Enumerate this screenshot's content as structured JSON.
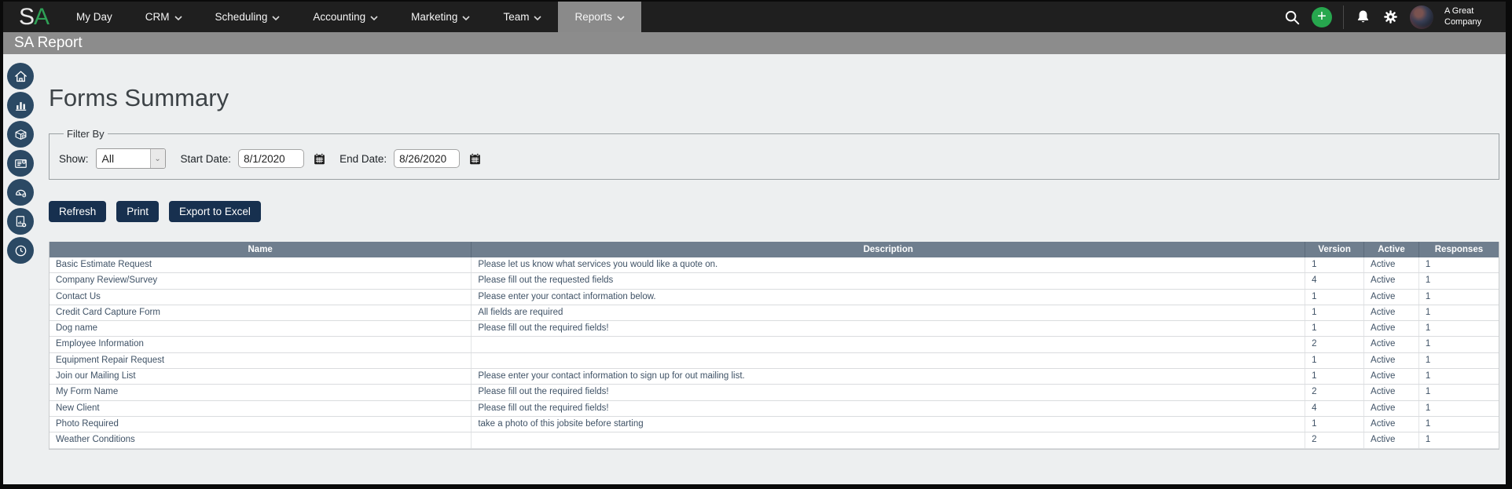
{
  "nav": {
    "logo": {
      "s": "S",
      "a": "A"
    },
    "items": [
      {
        "label": "My Day"
      },
      {
        "label": "CRM"
      },
      {
        "label": "Scheduling"
      },
      {
        "label": "Accounting"
      },
      {
        "label": "Marketing"
      },
      {
        "label": "Team"
      },
      {
        "label": "Reports"
      }
    ],
    "active_item": "Reports",
    "company": "A Great Company",
    "right_icons": [
      "search-icon",
      "add-icon",
      "notifications-icon",
      "settings-icon",
      "avatar"
    ]
  },
  "subheader": {
    "title": "SA Report"
  },
  "sidebar": {
    "icons": [
      "home-icon",
      "bar-chart-icon",
      "package-icon",
      "forms-icon",
      "gauge-icon",
      "report-add-icon",
      "clock-icon"
    ]
  },
  "main": {
    "title": "Forms Summary",
    "filter": {
      "legend": "Filter By",
      "show_label": "Show:",
      "show_value": "All",
      "start_label": "Start Date:",
      "start_value": "8/1/2020",
      "end_label": "End Date:",
      "end_value": "8/26/2020"
    },
    "actions": {
      "refresh": "Refresh",
      "print": "Print",
      "export": "Export to Excel"
    },
    "table": {
      "columns": [
        "Name",
        "Description",
        "Version",
        "Active",
        "Responses"
      ],
      "rows": [
        [
          "Basic Estimate Request",
          "Please let us know what services you would like a quote on.",
          "1",
          "Active",
          "1"
        ],
        [
          "Company Review/Survey",
          "Please fill out the requested fields",
          "4",
          "Active",
          "1"
        ],
        [
          "Contact Us",
          "Please enter your contact information below.",
          "1",
          "Active",
          "1"
        ],
        [
          "Credit Card Capture Form",
          "All fields are required",
          "1",
          "Active",
          "1"
        ],
        [
          "Dog name",
          "Please fill out the required fields!",
          "1",
          "Active",
          "1"
        ],
        [
          "Employee Information",
          "",
          "2",
          "Active",
          "1"
        ],
        [
          "Equipment Repair Request",
          "",
          "1",
          "Active",
          "1"
        ],
        [
          "Join our Mailing List",
          "Please enter your contact information to sign up for out mailing list.",
          "1",
          "Active",
          "1"
        ],
        [
          "My Form Name",
          "Please fill out the required fields!",
          "2",
          "Active",
          "1"
        ],
        [
          "New Client",
          "Please fill out the required fields!",
          "4",
          "Active",
          "1"
        ],
        [
          "Photo Required",
          "take a photo of this jobsite before starting",
          "1",
          "Active",
          "1"
        ],
        [
          "Weather Conditions",
          "",
          "2",
          "Active",
          "1"
        ]
      ]
    }
  },
  "colors": {
    "accent_green": "#2fa056",
    "nav_bg": "#1f1f1f",
    "subheader_bg": "#8c8c8c",
    "button_navy": "#17304f",
    "table_header": "#6f7e8e",
    "sidebar_circle": "#2b4964"
  }
}
